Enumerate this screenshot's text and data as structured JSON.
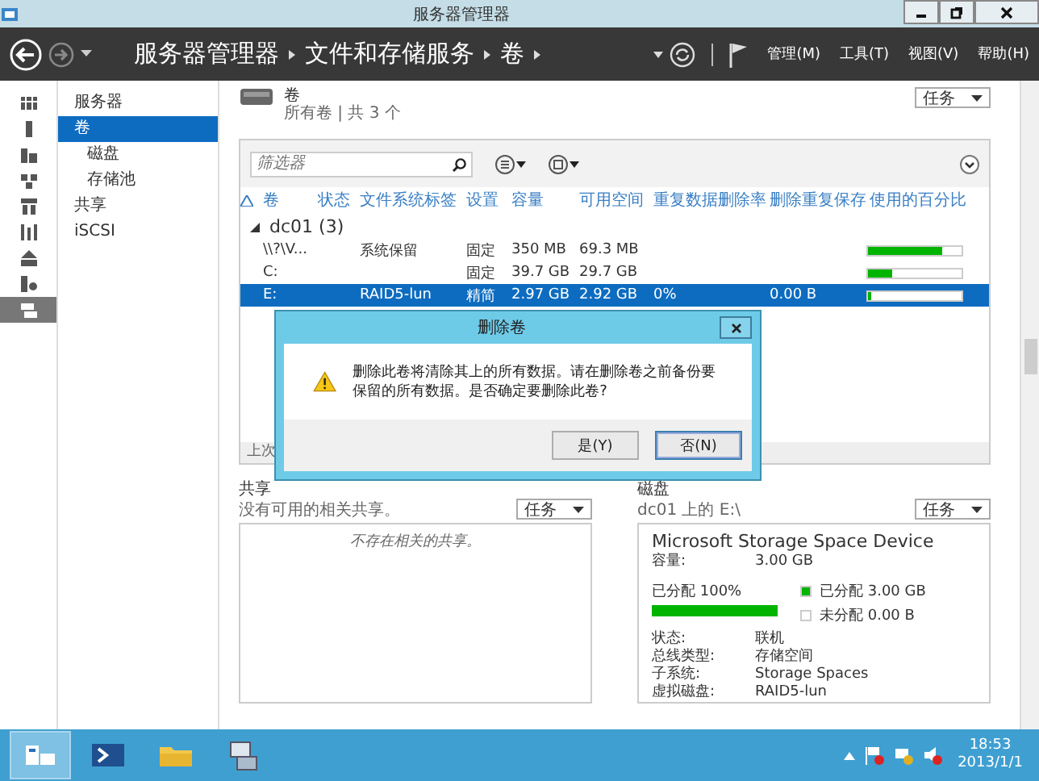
{
  "window": {
    "title": "服务器管理器"
  },
  "nav": {
    "breadcrumb": [
      "服务器管理器",
      "文件和存储服务",
      "卷"
    ],
    "menu": [
      "管理(M)",
      "工具(T)",
      "视图(V)",
      "帮助(H)"
    ]
  },
  "icon_rail": [
    {
      "kind": "dashboard",
      "selected": false
    },
    {
      "kind": "server",
      "selected": false
    },
    {
      "kind": "servers",
      "selected": false
    },
    {
      "kind": "network",
      "selected": false
    },
    {
      "kind": "cluster",
      "selected": false
    },
    {
      "kind": "tools",
      "selected": false
    },
    {
      "kind": "shares",
      "selected": false
    },
    {
      "kind": "iis",
      "selected": false
    },
    {
      "kind": "storage",
      "selected": true
    }
  ],
  "sidebar": {
    "items": [
      {
        "label": "服务器",
        "selected": false
      },
      {
        "label": "卷",
        "selected": true,
        "children": [
          {
            "label": "磁盘",
            "selected": false
          },
          {
            "label": "存储池",
            "selected": false
          }
        ]
      },
      {
        "label": "共享",
        "selected": false
      },
      {
        "label": "iSCSI",
        "selected": false
      }
    ]
  },
  "volumes": {
    "title": "卷",
    "subtitle": "所有卷 | 共 3 个",
    "tasks": "任务",
    "filter": {
      "placeholder": "筛选器"
    },
    "columns": [
      "卷",
      "状态",
      "文件系统标签",
      "设置",
      "容量",
      "可用空间",
      "重复数据删除率",
      "删除重复保存",
      "使用的百分比"
    ],
    "groups": [
      {
        "label": "dc01 (3)",
        "expanded": true,
        "rows": [
          {
            "cells": [
              "\\\\?\\V...",
              "",
              "系统保留",
              "固定",
              "350 MB",
              "69.3 MB",
              "",
              ""
            ],
            "level": 0.8,
            "selected": false
          },
          {
            "cells": [
              "C:",
              "",
              "",
              "固定",
              "39.7 GB",
              "29.7 GB",
              "",
              ""
            ],
            "level": 0.25,
            "selected": false
          },
          {
            "cells": [
              "E:",
              "",
              "RAID5-lun",
              "精简",
              "2.97 GB",
              "2.92 GB",
              "0%",
              "0.00 B"
            ],
            "level": 0.03,
            "selected": true
          }
        ]
      }
    ],
    "status": "上次"
  },
  "dialog": {
    "title": "删除卷",
    "message": "删除此卷将清除其上的所有数据。请在删除卷之前备份要保留的所有数据。是否确定要删除此卷?",
    "buttons": [
      {
        "label": "是(Y)",
        "selected": false
      },
      {
        "label": "否(N)",
        "selected": true
      }
    ]
  },
  "shares": {
    "title": "共享",
    "subtitle": "没有可用的相关共享。",
    "tasks": "任务",
    "empty": "不存在相关的共享。"
  },
  "disk": {
    "title": "磁盘",
    "subtitle": "dc01 上的 E:\\",
    "tasks": "任务",
    "device": "Microsoft Storage Space Device",
    "capacity": {
      "label": "容量:",
      "value": "3.00 GB"
    },
    "allocation": {
      "label": "已分配 100%",
      "level": 1
    },
    "legend": [
      {
        "label": "已分配 3.00 GB",
        "color": "#00b400"
      },
      {
        "label": "未分配 0.00 B",
        "color": "#ffffff"
      }
    ],
    "properties": [
      {
        "label": "状态:",
        "value": "联机"
      },
      {
        "label": "总线类型:",
        "value": "存储空间"
      },
      {
        "label": "子系统:",
        "value": "Storage Spaces"
      },
      {
        "label": "虚拟磁盘:",
        "value": "RAID5-lun"
      }
    ]
  },
  "taskbar": {
    "apps": [
      {
        "kind": "server-manager",
        "selected": true
      },
      {
        "kind": "powershell",
        "selected": false
      },
      {
        "kind": "explorer",
        "selected": false
      },
      {
        "kind": "network",
        "selected": false
      }
    ],
    "time": "18:53",
    "date": "2013/1/1"
  }
}
